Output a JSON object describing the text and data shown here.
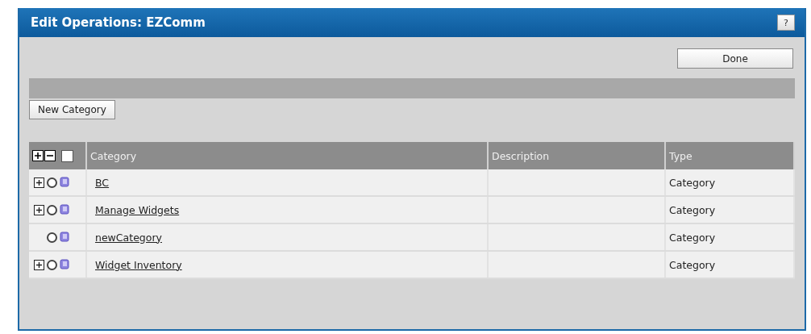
{
  "window": {
    "title": "Edit Operations: EZComm",
    "help_button": "?"
  },
  "done_button": "Done",
  "new_category_button": "New Category",
  "table": {
    "select_all_checked": false,
    "columns": [
      "Category",
      "Description",
      "Type"
    ],
    "rows": [
      {
        "category": "BC",
        "type": "Category",
        "expandable": true,
        "selected": false
      },
      {
        "category": "Manage Widgets",
        "type": "Category",
        "expandable": true,
        "selected": false
      },
      {
        "category": "newCategory",
        "type": "Category",
        "expandable": false,
        "selected": false
      },
      {
        "category": "Widget Inventory",
        "type": "Category",
        "expandable": true,
        "selected": false
      }
    ]
  }
}
